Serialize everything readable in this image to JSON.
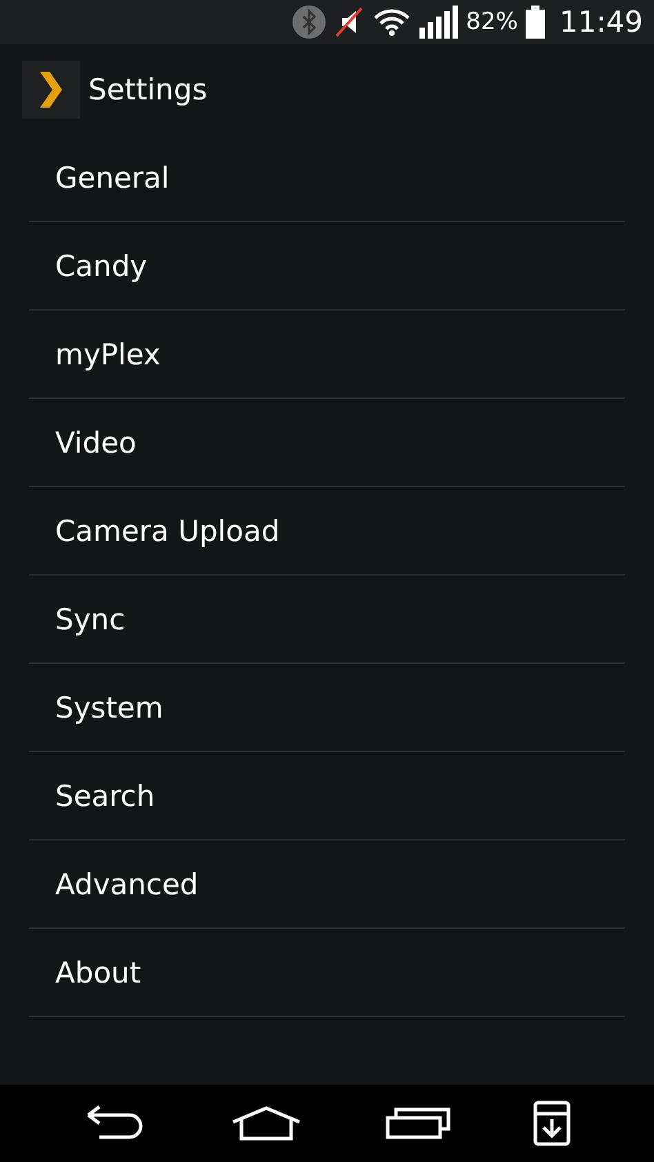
{
  "status_bar": {
    "battery": "82%",
    "time": "11:49"
  },
  "action_bar": {
    "title": "Settings"
  },
  "items": [
    {
      "label": "General"
    },
    {
      "label": "Candy"
    },
    {
      "label": "myPlex"
    },
    {
      "label": "Video"
    },
    {
      "label": "Camera Upload"
    },
    {
      "label": "Sync"
    },
    {
      "label": "System"
    },
    {
      "label": "Search"
    },
    {
      "label": "Advanced"
    },
    {
      "label": "About"
    }
  ]
}
